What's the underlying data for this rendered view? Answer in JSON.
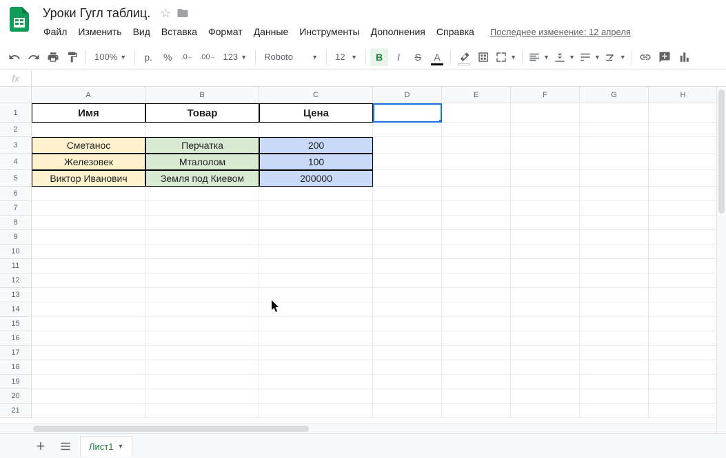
{
  "doc_title": "Уроки Гугл таблиц.",
  "menu": [
    "Файл",
    "Изменить",
    "Вид",
    "Вставка",
    "Формат",
    "Данные",
    "Инструменты",
    "Дополнения",
    "Справка"
  ],
  "last_edit": "Последнее изменение: 12 апреля",
  "toolbar": {
    "zoom": "100%",
    "currency": "р.",
    "percent": "%",
    "dec_dec": ".0",
    "dec_inc": ".00",
    "num_fmt": "123",
    "font": "Roboto",
    "size": "12"
  },
  "columns": [
    "A",
    "B",
    "C",
    "D",
    "E",
    "F",
    "G",
    "H"
  ],
  "row_count": 21,
  "selected": "D1",
  "table": {
    "headers": [
      "Имя",
      "Товар",
      "Цена"
    ],
    "rows": [
      [
        "Сметанос",
        "Перчатка",
        "200"
      ],
      [
        "Железовек",
        "Мталолом",
        "100"
      ],
      [
        "Виктор Иванович",
        "Земля под Киевом",
        "200000"
      ]
    ]
  },
  "sheet_tab": "Лист1"
}
